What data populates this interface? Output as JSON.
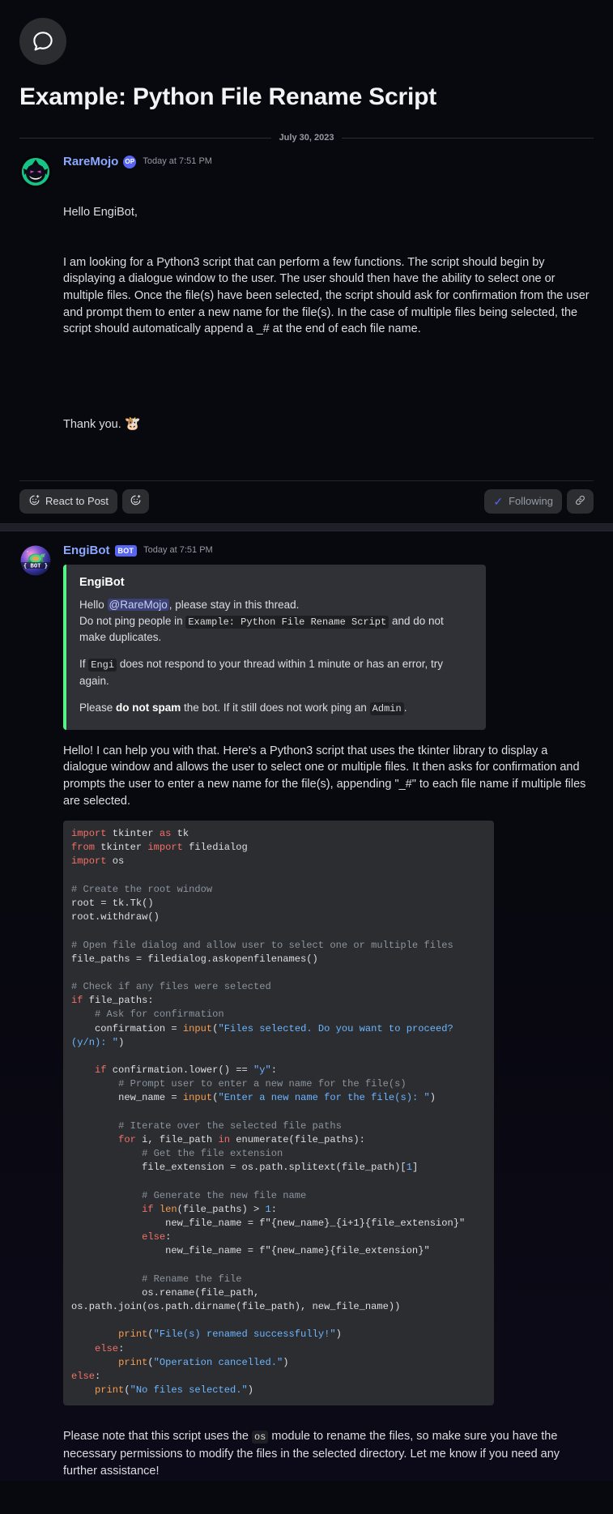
{
  "thread": {
    "icon": "speech-bubble-icon",
    "title": "Example: Python File Rename Script",
    "date_divider": "July 30, 2023"
  },
  "posts": [
    {
      "author": "RareMojo",
      "author_badge": "OP",
      "timestamp": "Today at 7:51 PM",
      "avatar": "gengar-avatar",
      "greeting": "Hello EngiBot,",
      "body": "I am looking for a Python3 script that can perform a few functions. The script should begin by displaying a dialogue window to the user. The user should then have the ability to select one or multiple files. Once the file(s) have been selected, the script should ask for confirmation from the user and prompt them to enter a new name for the file(s). In the case of multiple files being selected, the script should automatically append a _# at the end of each file name.",
      "closing": "Thank you.",
      "closing_emoji": "🐮"
    },
    {
      "author": "EngiBot",
      "author_badge": "BOT",
      "timestamp": "Today at 7:51 PM",
      "avatar": "cosmic-turtle-bot-avatar",
      "avatar_label": "{ BOT }"
    }
  ],
  "action_bar": {
    "react_label": "React to Post",
    "react_icon": "add-reaction-icon",
    "add_reaction_icon": "emoji-plus-icon",
    "following_label": "Following",
    "following_check": "✓",
    "link_icon": "link-icon"
  },
  "embed": {
    "accent_color": "#57f287",
    "title": "EngiBot",
    "line1_pre": "Hello ",
    "line1_mention": "@RareMojo",
    "line1_post": ", please stay in this thread.",
    "line2_pre": "Do not ping people in ",
    "line2_code": "Example: Python File Rename Script",
    "line2_post": " and do not make duplicates.",
    "line3_pre": "If ",
    "line3_code": "Engi",
    "line3_post": " does not respond to your thread within 1 minute or has an error, try again.",
    "line4_pre": "Please ",
    "line4_bold": "do not spam",
    "line4_mid": " the bot. If it still does not work ping an ",
    "line4_code": "Admin",
    "line4_post": "."
  },
  "bot_reply": {
    "intro": "Hello! I can help you with that. Here's a Python3 script that uses the tkinter library to display a dialogue window and allows the user to select one or multiple files. It then asks for confirmation and prompts the user to enter a new name for the file(s), appending \"_#\" to each file name if multiple files are selected.",
    "code_language": "python",
    "code": "import tkinter as tk\nfrom tkinter import filedialog\nimport os\n\n# Create the root window\nroot = tk.Tk()\nroot.withdraw()\n\n# Open file dialog and allow user to select one or multiple files\nfile_paths = filedialog.askopenfilenames()\n\n# Check if any files were selected\nif file_paths:\n    # Ask for confirmation\n    confirmation = input(\"Files selected. Do you want to proceed? (y/n): \")\n\n    if confirmation.lower() == \"y\":\n        # Prompt user to enter a new name for the file(s)\n        new_name = input(\"Enter a new name for the file(s): \")\n\n        # Iterate over the selected file paths\n        for i, file_path in enumerate(file_paths):\n            # Get the file extension\n            file_extension = os.path.splitext(file_path)[1]\n\n            # Generate the new file name\n            if len(file_paths) > 1:\n                new_file_name = f\"{new_name}_{i+1}{file_extension}\"\n            else:\n                new_file_name = f\"{new_name}{file_extension}\"\n\n            # Rename the file\n            os.rename(file_path, os.path.join(os.path.dirname(file_path), new_file_name))\n\n        print(\"File(s) renamed successfully!\")\n    else:\n        print(\"Operation cancelled.\")\nelse:\n    print(\"No files selected.\")",
    "outro_pre": "Please note that this script uses the ",
    "outro_code": "os",
    "outro_post": " module to rename the files, so make sure you have the necessary permissions to modify the files in the selected directory. Let me know if you need any further assistance!"
  },
  "colors": {
    "background": "#08080f",
    "author_link": "#8ba8ff",
    "badge_blurple": "#5865f2",
    "embed_accent": "#57f287",
    "code_bg": "#2b2d31",
    "embed_bg": "#2f3136"
  }
}
